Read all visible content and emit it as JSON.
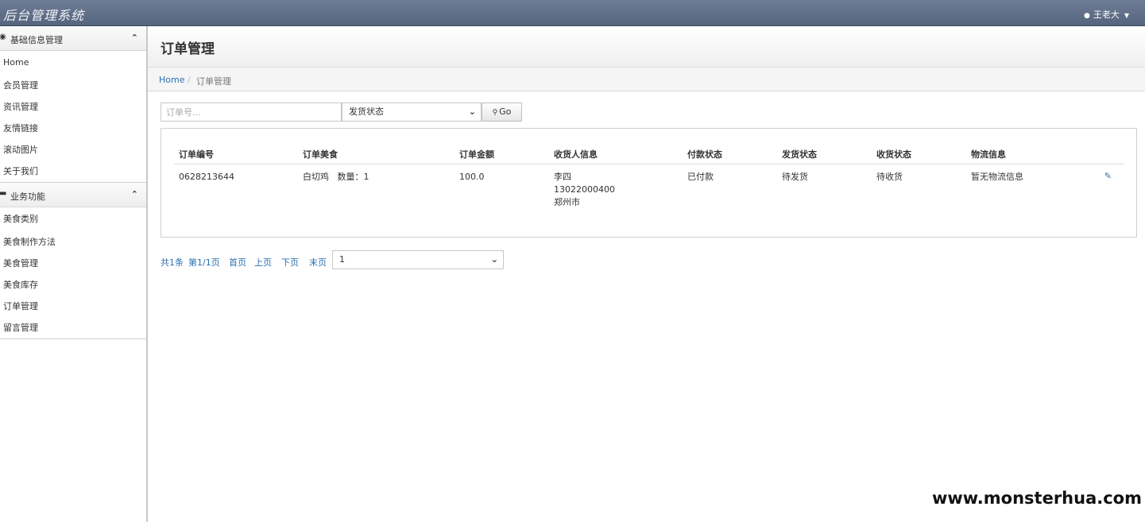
{
  "app": {
    "title": "后台管理系统"
  },
  "user": {
    "name": "王老大"
  },
  "sidebar": {
    "groups": [
      {
        "label": "基础信息管理",
        "items": [
          "Home",
          "会员管理",
          "资讯管理",
          "友情链接",
          "滚动图片",
          "关于我们"
        ]
      },
      {
        "label": "业务功能",
        "items": [
          "美食类别",
          "美食制作方法",
          "美食管理",
          "美食库存",
          "订单管理",
          "留言管理"
        ]
      }
    ]
  },
  "page": {
    "title": "订单管理"
  },
  "breadcrumb": {
    "home": "Home",
    "separator": "/",
    "current": "订单管理"
  },
  "filter": {
    "order_placeholder": "订单号...",
    "status_selected": "发货状态",
    "go_label": "Go"
  },
  "table": {
    "headers": [
      "订单编号",
      "订单美食",
      "订单金额",
      "收货人信息",
      "付款状态",
      "发货状态",
      "收货状态",
      "物流信息"
    ],
    "rows": [
      {
        "order_no": "0628213644",
        "food": "白切鸡   数量：1",
        "amount": "100.0",
        "receiver_name": "李四",
        "receiver_phone": "13022000400",
        "receiver_city": "郑州市",
        "pay_status": "已付款",
        "ship_status": "待发货",
        "receive_status": "待收货",
        "logistics": "暂无物流信息"
      }
    ]
  },
  "pager": {
    "total": "共1条",
    "page_info": "第1/1页",
    "first": "首页",
    "prev": "上页",
    "next": "下页",
    "last": "末页",
    "selected_page": "1"
  },
  "watermark": "www.monsterhua.com",
  "colors": {
    "topbar": "#5f6e87",
    "link": "#2a6fb0"
  }
}
